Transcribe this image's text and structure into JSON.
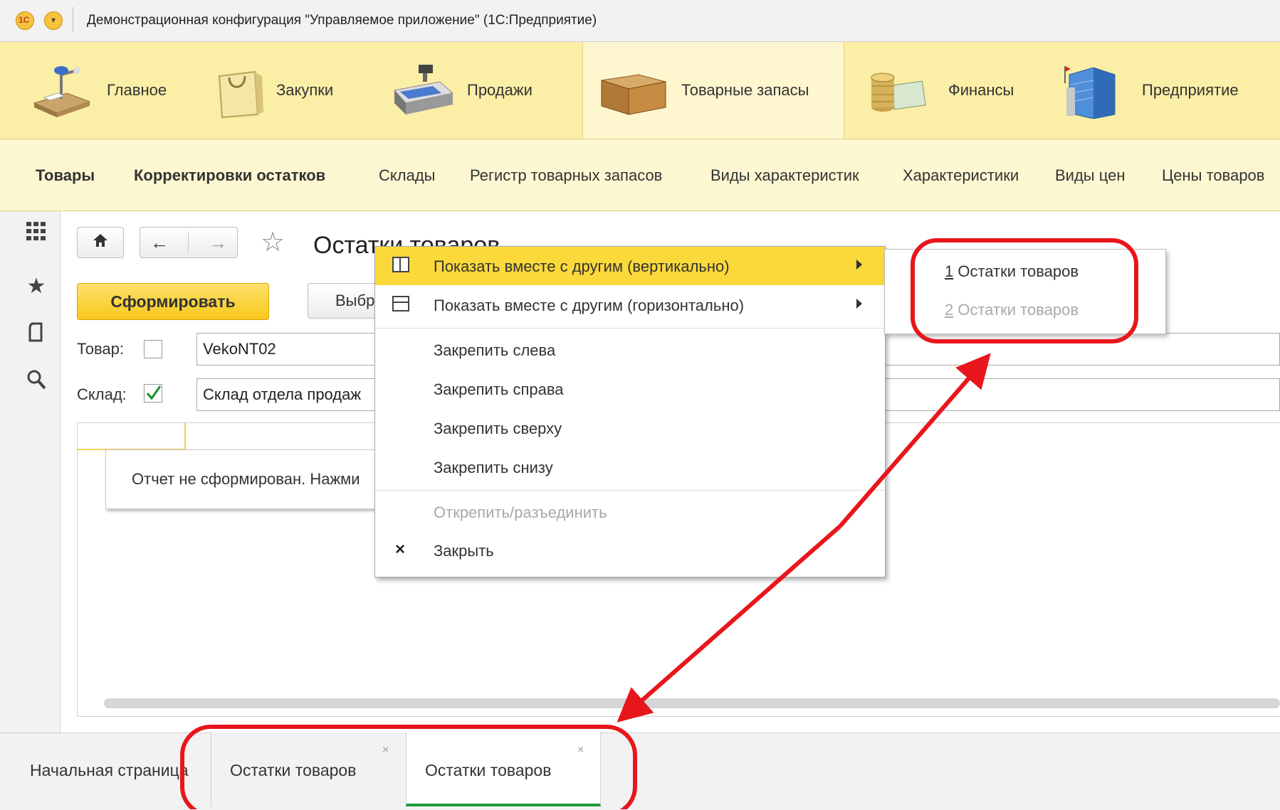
{
  "app": {
    "title": "Демонстрационная конфигурация \"Управляемое приложение\"  (1С:Предприятие)",
    "logo_text": "1С"
  },
  "sections": [
    {
      "label": "Главное",
      "icon": "desk-lamp-icon"
    },
    {
      "label": "Закупки",
      "icon": "shopping-bag-icon"
    },
    {
      "label": "Продажи",
      "icon": "cash-register-icon"
    },
    {
      "label": "Товарные запасы",
      "icon": "box-icon",
      "active": true
    },
    {
      "label": "Финансы",
      "icon": "coins-icon"
    },
    {
      "label": "Предприятие",
      "icon": "building-icon"
    }
  ],
  "subnav": [
    {
      "label": "Товары",
      "bold": true
    },
    {
      "label": "Корректировки остатков",
      "bold": true
    },
    {
      "label": "Склады"
    },
    {
      "label": "Регистр товарных запасов"
    },
    {
      "label": "Виды характеристик"
    },
    {
      "label": "Характеристики"
    },
    {
      "label": "Виды цен"
    },
    {
      "label": "Цены товаров"
    }
  ],
  "left_panel": [
    "apps-grid-icon",
    "star-icon",
    "history-icon",
    "search-icon"
  ],
  "form": {
    "title": "Остатки товаров",
    "generate_label": "Сформировать",
    "select_label": "Выбр",
    "product_label": "Товар:",
    "product_checked": false,
    "product_value": "VekoNT02",
    "warehouse_label": "Склад:",
    "warehouse_checked": true,
    "warehouse_value": "Склад отдела продаж",
    "notice": "Отчет не сформирован. Нажми"
  },
  "context_menu": {
    "items": [
      {
        "label": "Показать вместе с другим (вертикально)",
        "icon": "split-vertical-icon",
        "submenu": true,
        "highlighted": true
      },
      {
        "label": "Показать вместе с другим (горизонтально)",
        "icon": "split-horizontal-icon",
        "submenu": true
      },
      {
        "label": "Закрепить слева"
      },
      {
        "label": "Закрепить справа"
      },
      {
        "label": "Закрепить сверху"
      },
      {
        "label": "Закрепить снизу"
      },
      {
        "label": "Открепить/разъединить",
        "disabled": true
      },
      {
        "label": "Закрыть",
        "icon": "close-icon"
      }
    ]
  },
  "submenu": {
    "items": [
      {
        "num": "1",
        "label": " Остатки товаров",
        "disabled": false
      },
      {
        "num": "2",
        "label": " Остатки товаров",
        "disabled": true
      }
    ]
  },
  "tabs": [
    {
      "label": "Начальная страница"
    },
    {
      "label": "Остатки товаров",
      "close": "×"
    },
    {
      "label": "Остатки товаров",
      "close": "×",
      "active": true
    }
  ],
  "colors": {
    "sections_bg": "#fbeea6",
    "subnav_bg": "#fdf7d2",
    "highlight": "#fbd93a",
    "annotation_red": "#e8161c",
    "active_tab_underline": "#1e9a3c"
  }
}
